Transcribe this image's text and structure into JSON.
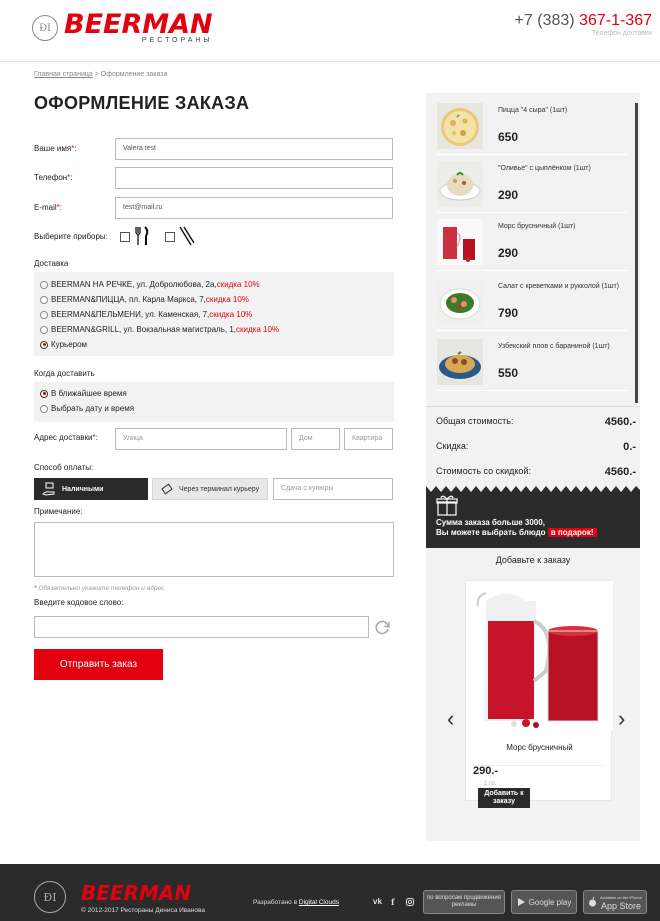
{
  "header": {
    "logo_word": "BEERMAN",
    "logo_sub": "РЕСТОРАНЫ",
    "logo_mark": "ĐI",
    "phone_prefix": "+7 (383)",
    "phone_number": "367-1-367",
    "phone_caption": "Телефон доставки"
  },
  "breadcrumb": {
    "home": "Главная страница",
    "separator": ">",
    "current": "Оформление заказа"
  },
  "page_title": "ОФОРМЛЕНИЕ ЗАКАЗА",
  "form": {
    "name_label": "Ваше имя",
    "name_value": "Valera test",
    "phone_label": "Телефон",
    "phone_value": "",
    "email_label": "E-mail",
    "email_value": "test@mail.ru",
    "req_mark": "*",
    "colon": ":",
    "cutlery_label": "Выберите приборы:",
    "delivery_label": "Доставка",
    "delivery_options": [
      {
        "text": "BEERMAN НА РЕЧКЕ, ул. Добролюбова, 2а, ",
        "discount": "скидка 10%"
      },
      {
        "text": "BEERMAN&ПИЦЦА, пл. Карла Маркса, 7, ",
        "discount": "скидка 10%"
      },
      {
        "text": "BEERMAN&ПЕЛЬМЕНИ, ул. Каменская, 7, ",
        "discount": "скидка 10%"
      },
      {
        "text": "BEERMAN&GRILL, ул. Вокзальная магистраль, 1, ",
        "discount": "скидка 10%"
      },
      {
        "text": "Курьером",
        "discount": ""
      }
    ],
    "when_label": "Когда доставить",
    "when_options": [
      "В ближайшее время",
      "Выбрать дату и время"
    ],
    "address_label": "Адрес доставки",
    "street_placeholder": "Улица",
    "house_placeholder": "Дом",
    "flat_placeholder": "Квартира",
    "payment_label": "Способ оплаты:",
    "pay_cash": "Наличными",
    "pay_terminal": "Через терминал курьеру",
    "change_placeholder": "Сдача с купюры",
    "note_label": "Примечание:",
    "required_note": "Обязательно укажите телефон и адрес",
    "code_label": "Введите кодовое слово:",
    "submit_label": "Отправить заказ"
  },
  "cart": {
    "items": [
      {
        "name": "Пицца \"4 сыра\" (1шт)",
        "price": "650"
      },
      {
        "name": "\"Оливье\" с цыплёнком (1шт)",
        "price": "290"
      },
      {
        "name": "Морс брусничный (1шт)",
        "price": "290"
      },
      {
        "name": "Салат с креветками и рукколой (1шт)",
        "price": "790"
      },
      {
        "name": "Узбекский плов с бараниной (1шт)",
        "price": "550"
      }
    ],
    "total_label": "Общая стоимость:",
    "total_value": "4560.-",
    "discount_label": "Скидка:",
    "discount_value": "0.-",
    "final_label": "Стоимость со скидкой:",
    "final_value": "4560.-"
  },
  "promo": {
    "line1": "Сумма заказа больше 3000,",
    "line2": "Вы можете выбрать блюдо",
    "badge": "в подарок!"
  },
  "upsell": {
    "title": "Добавьте к заказу",
    "product_name": "Морс брусничный",
    "product_price": "290.-",
    "product_weight": "1 гр.",
    "add_button": "Добавить к заказу"
  },
  "footer": {
    "logo_word": "BEERMAN",
    "copyright": "© 2012-2017 Рестораны Дениса Иванова",
    "dev_prefix": "Разработано в",
    "dev_link": "Digital Clouds",
    "ads_btn": "по вопросам продвижения рекламы",
    "google_play": "Google play",
    "app_store": "App Store",
    "app_store_small": "Available on the iPhone"
  },
  "colors": {
    "brand_red": "#e3000f",
    "dark": "#2b2b2b",
    "panel_grey": "#f2f2f2"
  }
}
